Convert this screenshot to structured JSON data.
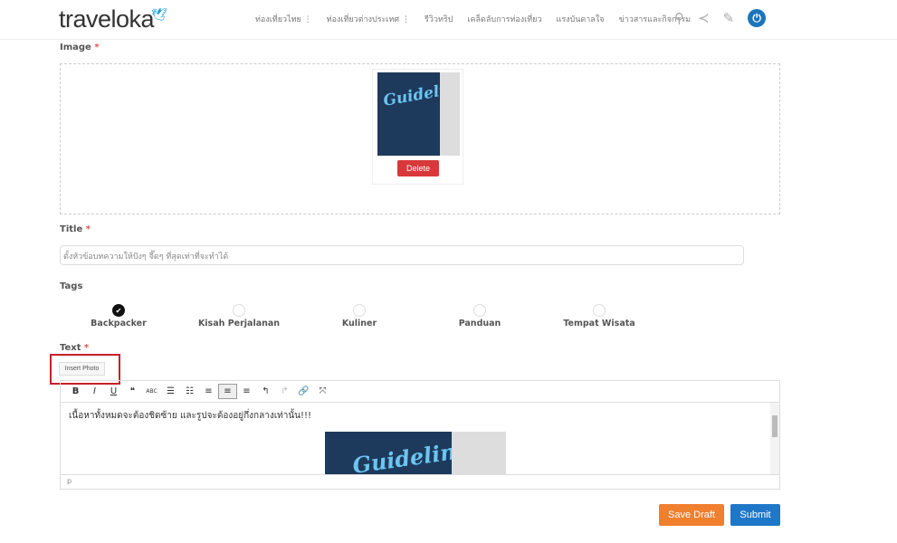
{
  "header": {
    "logo": "traveloka",
    "nav": [
      "ท่องเที่ยวไทย ⋮",
      "ท่องเที่ยวต่างประเทศ ⋮",
      "รีวิวทริป",
      "เคล็ดลับการท่องเที่ยว",
      "แรงบันดาลใจ",
      "ข่าวสารและกิจกรรม"
    ]
  },
  "image": {
    "label": "Image",
    "required": "*",
    "thumb_text": "Guideline",
    "delete": "Delete"
  },
  "title": {
    "label": "Title",
    "required": "*",
    "placeholder": "ตั้งหัวข้อบทความให้ปังๆ จี๊ดๆ ที่สุดเท่าที่จะทำได้"
  },
  "tags": {
    "label": "Tags",
    "items": [
      {
        "label": "Backpacker",
        "checked": true
      },
      {
        "label": "Kisah Perjalanan",
        "checked": false
      },
      {
        "label": "Kuliner",
        "checked": false
      },
      {
        "label": "Panduan",
        "checked": false
      },
      {
        "label": "Tempat Wisata",
        "checked": false
      }
    ]
  },
  "text": {
    "label": "Text",
    "required": "*",
    "insert_photo": "Insert Photo",
    "content": "เนื้อหาทั้งหมดจะต้องชิดซ้าย และรูปจะต้องอยู่กึ่งกลางเท่านั้น!!!",
    "image_text": "Guideline",
    "status_path": "p"
  },
  "actions": {
    "save_draft": "Save Draft",
    "submit": "Submit"
  },
  "colors": {
    "accent": "#1b75bc",
    "delete": "#d9383a",
    "save_draft": "#f07f2e",
    "submit": "#1f77c8",
    "highlight": "#c8202a"
  }
}
